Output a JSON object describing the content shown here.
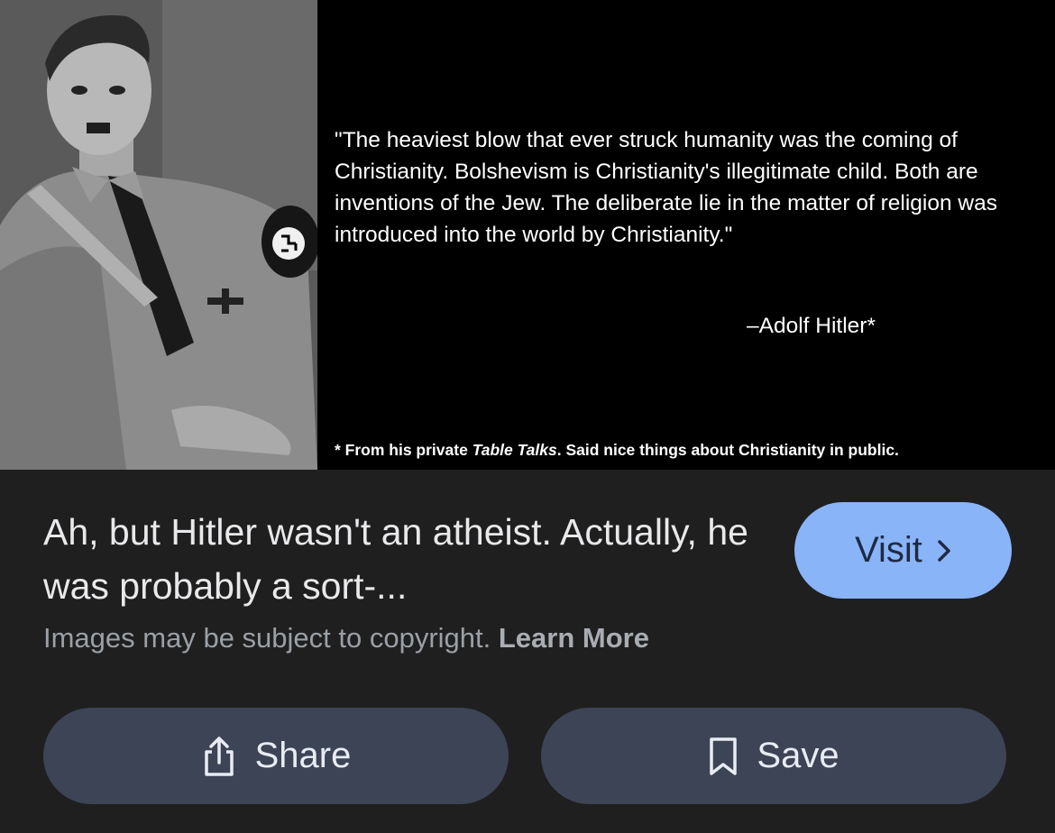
{
  "preview_image": {
    "quote": "\"The heaviest blow that ever struck humanity was the coming of Christianity.  Bolshevism is Christianity's illegitimate child. Both are inventions of the Jew. The deliberate lie in the matter of religion was introduced into the world by Christianity.\"",
    "attribution": "–Adolf Hitler*",
    "footnote": {
      "prefix": "* From his private ",
      "italic": "Table Talks",
      "suffix": ".  Said nice things about Christianity in public."
    },
    "photo_icon": "portrait-photo"
  },
  "result": {
    "title": "Ah, but Hitler wasn't an atheist. Actually, he was probably a sort-...",
    "visit_label": "Visit",
    "visit_icon": "chevron-right-icon",
    "copyright_text": "Images may be subject to copyright.",
    "learn_more_label": "Learn More"
  },
  "actions": {
    "share_label": "Share",
    "share_icon": "share-icon",
    "save_label": "Save",
    "save_icon": "bookmark-icon"
  },
  "colors": {
    "background": "#1f1f1f",
    "visit_button": "#8ab4f8",
    "action_button": "#3c4455"
  }
}
